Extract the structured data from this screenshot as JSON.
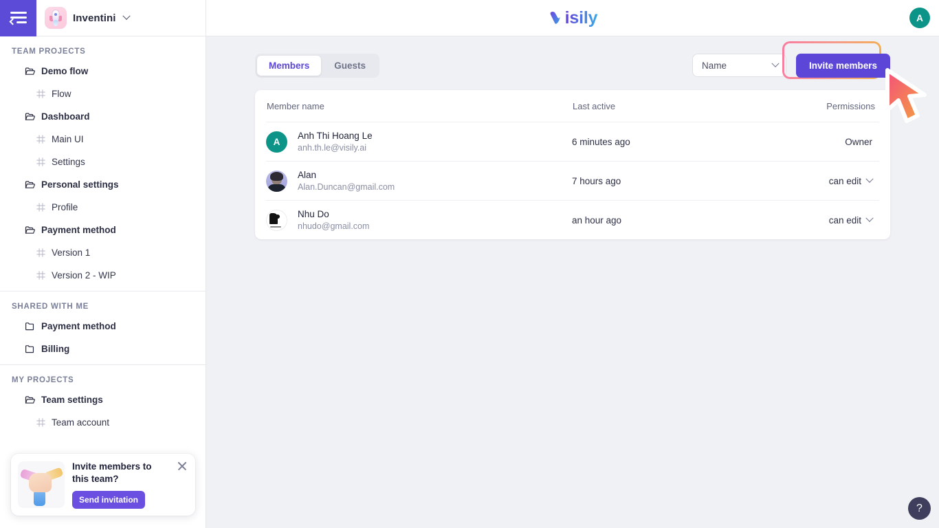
{
  "sidebar": {
    "collapse_icon": "sidebar-collapse-icon",
    "team_avatar_icon": "rocket-avatar-icon",
    "team_name": "Inventini",
    "team_chevron_icon": "chevron-down-icon",
    "sections": [
      {
        "title": "TEAM PROJECTS",
        "items": [
          {
            "label": "Demo flow",
            "icon": "folder-open-icon",
            "type": "folder"
          },
          {
            "label": "Flow",
            "icon": "frame-icon",
            "type": "page"
          },
          {
            "label": "Dashboard",
            "icon": "folder-open-icon",
            "type": "folder"
          },
          {
            "label": "Main UI",
            "icon": "frame-icon",
            "type": "page"
          },
          {
            "label": "Settings",
            "icon": "frame-icon",
            "type": "page"
          },
          {
            "label": "Personal settings",
            "icon": "folder-open-icon",
            "type": "folder"
          },
          {
            "label": "Profile",
            "icon": "frame-icon",
            "type": "page"
          },
          {
            "label": "Payment method",
            "icon": "folder-open-icon",
            "type": "folder"
          },
          {
            "label": "Version 1",
            "icon": "frame-icon",
            "type": "page"
          },
          {
            "label": "Version 2 - WIP",
            "icon": "frame-icon",
            "type": "page"
          }
        ]
      },
      {
        "title": "SHARED WITH ME",
        "items": [
          {
            "label": "Payment method",
            "icon": "folder-icon",
            "type": "folder"
          },
          {
            "label": "Billing",
            "icon": "folder-icon",
            "type": "folder"
          }
        ]
      },
      {
        "title": "MY PROJECTS",
        "items": [
          {
            "label": "Team settings",
            "icon": "folder-open-icon",
            "type": "folder"
          },
          {
            "label": "Team account",
            "icon": "frame-icon",
            "type": "page"
          }
        ]
      }
    ],
    "promo": {
      "illustration_icon": "hands-together-icon",
      "title": "Invite members to this team?",
      "button_label": "Send invitation",
      "close_icon": "close-icon"
    }
  },
  "topbar": {
    "logo_letter": "V",
    "logo_text": "isily",
    "avatar_initial": "A"
  },
  "toolbar": {
    "tabs": [
      {
        "label": "Members",
        "active": true
      },
      {
        "label": "Guests",
        "active": false
      }
    ],
    "sort_select": {
      "value": "Name",
      "chevron_icon": "chevron-down-icon"
    },
    "invite_button_label": "Invite members",
    "highlight_color_start": "#f97ba0",
    "highlight_color_end": "#f2b24f"
  },
  "table": {
    "headers": {
      "name": "Member name",
      "last_active": "Last active",
      "permissions": "Permissions"
    },
    "rows": [
      {
        "avatar_type": "initial",
        "avatar_initial": "A",
        "avatar_color": "#0c9488",
        "name": "Anh Thi Hoang Le",
        "email": "anh.th.le@visily.ai",
        "last_active": "6 minutes ago",
        "permission": "Owner",
        "permission_dropdown": false
      },
      {
        "avatar_type": "photo",
        "avatar_initial": "",
        "avatar_color": "#a8a7dd",
        "name": "Alan",
        "email": "Alan.Duncan@gmail.com",
        "last_active": "7 hours ago",
        "permission": "can edit",
        "permission_dropdown": true
      },
      {
        "avatar_type": "logo",
        "avatar_initial": "",
        "avatar_color": "#ffffff",
        "name": "Nhu Do",
        "email": "nhudo@gmail.com",
        "last_active": "an hour ago",
        "permission": "can edit",
        "permission_dropdown": true
      }
    ]
  },
  "overlay": {
    "cursor_icon": "mouse-pointer-icon",
    "help_button_label": "?"
  }
}
